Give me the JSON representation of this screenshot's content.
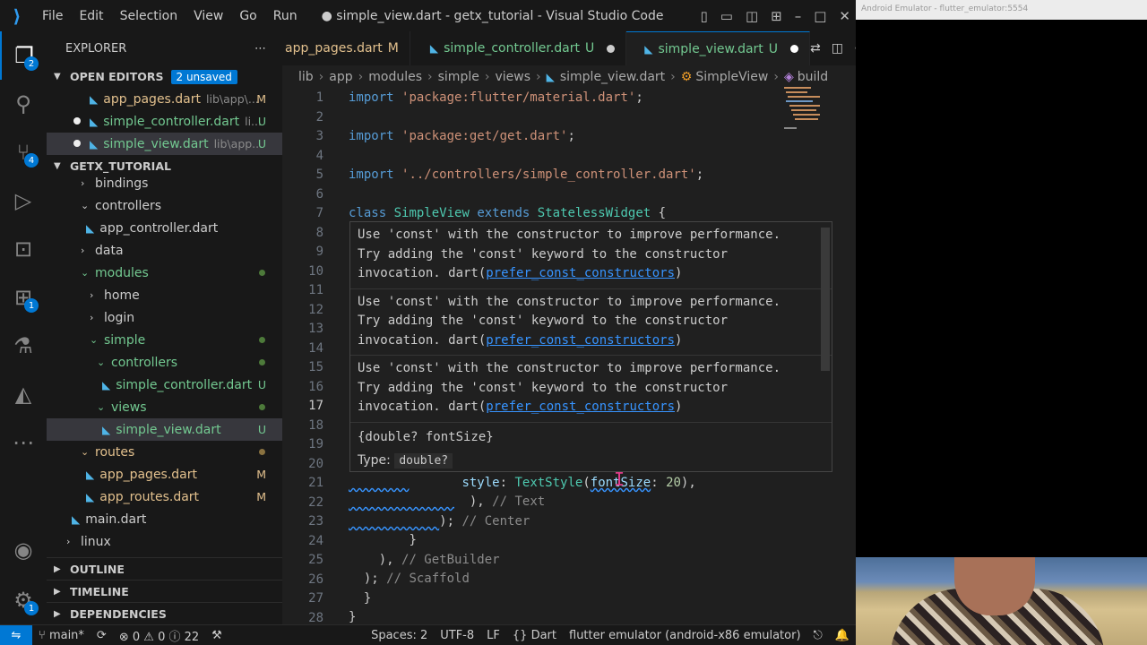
{
  "titlebar": {
    "menu": [
      "File",
      "Edit",
      "Selection",
      "View",
      "Go",
      "Run"
    ],
    "title": "● simple_view.dart - getx_tutorial - Visual Studio Code"
  },
  "activity": {
    "explorer_badge": "2",
    "scm_badge": "4",
    "extensions_badge": "1",
    "settings_badge": "1"
  },
  "sidebar": {
    "title": "EXPLORER",
    "open_editors_label": "OPEN EDITORS",
    "unsaved_badge": "2 unsaved",
    "open_editors": [
      {
        "name": "app_pages.dart",
        "path": "lib\\app\\...",
        "status": "M"
      },
      {
        "name": "simple_controller.dart",
        "path": "li...",
        "status": "U"
      },
      {
        "name": "simple_view.dart",
        "path": "lib\\app...",
        "status": "U"
      }
    ],
    "project_label": "GETX_TUTORIAL",
    "tree": {
      "bindings": "bindings",
      "controllers": "controllers",
      "app_controller": "app_controller.dart",
      "data": "data",
      "modules": "modules",
      "home": "home",
      "login": "login",
      "simple": "simple",
      "simple_controllers": "controllers",
      "simple_controller": "simple_controller.dart",
      "simple_controller_status": "U",
      "views": "views",
      "simple_view": "simple_view.dart",
      "simple_view_status": "U",
      "routes": "routes",
      "app_pages": "app_pages.dart",
      "app_pages_status": "M",
      "app_routes": "app_routes.dart",
      "app_routes_status": "M",
      "main": "main.dart",
      "linux": "linux"
    },
    "outline": "OUTLINE",
    "timeline": "TIMELINE",
    "dependencies": "DEPENDENCIES"
  },
  "tabs": [
    {
      "label": "app_pages.dart",
      "status": "M"
    },
    {
      "label": "simple_controller.dart",
      "status": "U"
    },
    {
      "label": "simple_view.dart",
      "status": "U"
    }
  ],
  "breadcrumb": [
    "lib",
    "app",
    "modules",
    "simple",
    "views",
    "simple_view.dart",
    "SimpleView",
    "build"
  ],
  "code": {
    "line_numbers": [
      "1",
      "2",
      "3",
      "4",
      "5",
      "6",
      "7",
      "8",
      "9",
      "10",
      "11",
      "12",
      "13",
      "14",
      "15",
      "16",
      "17",
      "18",
      "19",
      "20",
      "21",
      "22",
      "23",
      "24",
      "25",
      "26",
      "27",
      "28"
    ],
    "l1_kw": "import",
    "l1_str": "'package:flutter/material.dart'",
    "l3_kw": "import",
    "l3_str": "'package:get/get.dart'",
    "l5_kw": "import",
    "l5_str": "'../controllers/simple_controller.dart'",
    "l7_class": "class",
    "l7_name": "SimpleView",
    "l7_extends": "extends",
    "l7_base": "StatelessWidget",
    "l7_brace": " {",
    "l21_style": "style",
    "l21_ts": "TextStyle",
    "l21_fs": "fontSize",
    "l21_val": "20",
    "l22_cmt": "// Text",
    "l23_cmt": "// Center",
    "l24": "}",
    "l25_cmt": "// GetBuilder",
    "l26_cmt": "// Scaffold",
    "l27": "}",
    "l28": "}"
  },
  "hover": {
    "message_line1": "Use 'const' with the constructor to improve performance.",
    "message_line2": "Try adding the 'const' keyword to the constructor",
    "message_line3_prefix": "invocation. dart(",
    "message_link": "prefer_const_constructors",
    "message_line3_suffix": ")",
    "signature": "{double? fontSize}",
    "type_label": "Type:",
    "type_value": "double?"
  },
  "emulator": {
    "title": "Android Emulator - flutter_emulator:5554"
  },
  "statusbar": {
    "branch": "main*",
    "errors": "0",
    "warnings": "0",
    "infos": "22",
    "spaces": "Spaces: 2",
    "encoding": "UTF-8",
    "eol": "LF",
    "language_braces": "{}",
    "language": "Dart",
    "device": "flutter emulator (android-x86 emulator)"
  },
  "colors": {
    "accent": "#0078d4",
    "modified": "#e2c08d",
    "untracked": "#73c991"
  }
}
